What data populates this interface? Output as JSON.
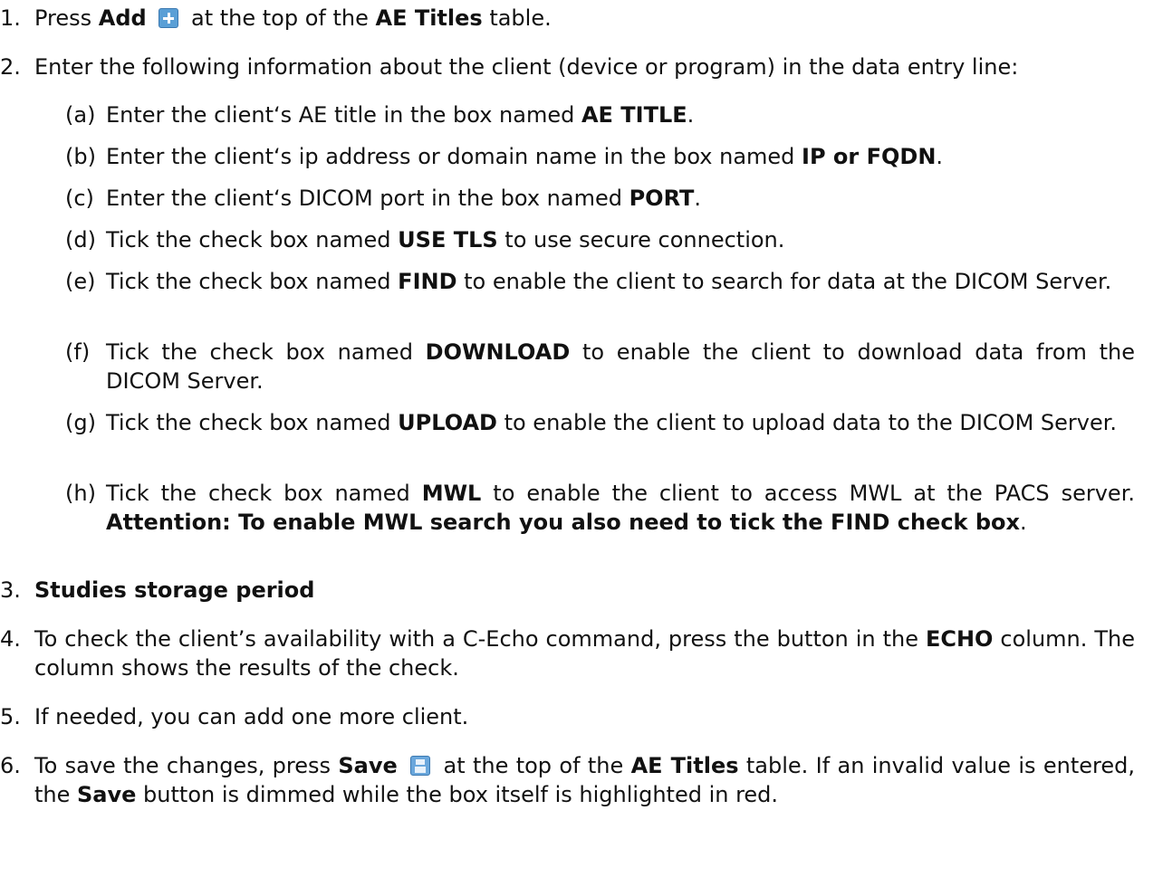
{
  "steps": [
    {
      "num": "1.",
      "before": "Press ",
      "bold1": "Add",
      "mid": " at the top of the ",
      "bold2": "AE Titles",
      "after": " table."
    },
    {
      "num": "2.",
      "text": "Enter the following information about the client (device or program) in the data entry line:"
    },
    {
      "num": "3.",
      "bold": "Studies storage period"
    },
    {
      "num": "4.",
      "before": "To check the client’s availability with a C-Echo command, press the button in the ",
      "bold": "ECHO",
      "after": " column. The column shows the results of the check."
    },
    {
      "num": "5.",
      "text": "If needed, you can add one more client."
    },
    {
      "num": "6.",
      "before": "To save the changes, press ",
      "bold1": "Save",
      "mid": " at the top of the ",
      "bold2": "AE Titles",
      "mid2": " table. If an invalid value is entered, the ",
      "bold3": "Save",
      "after": " button is dimmed while the box itself is highlighted in red."
    }
  ],
  "substeps": [
    {
      "label": "(a)",
      "before": "Enter the client‘s AE title in the box named ",
      "bold": "AE TITLE",
      "after": "."
    },
    {
      "label": "(b)",
      "before": "Enter the client‘s ip address or domain name in the box named ",
      "bold": "IP or FQDN",
      "after": "."
    },
    {
      "label": "(c)",
      "before": "Enter the client‘s DICOM port in the box named ",
      "bold": "PORT",
      "after": "."
    },
    {
      "label": "(d)",
      "before": "Tick the check box named ",
      "bold": "USE TLS",
      "after": " to use secure connection."
    },
    {
      "label": "(e)",
      "before": "Tick the check box named ",
      "bold": "FIND",
      "after": " to enable the client to search for data at the DICOM Server."
    },
    {
      "label": "(f)",
      "before": "Tick the check box named ",
      "bold": "DOWNLOAD",
      "after": " to enable the client to download data from the DICOM Server."
    },
    {
      "label": "(g)",
      "before": "Tick the check box named ",
      "bold": "UPLOAD",
      "after": " to enable the client to upload data to the DICOM Server."
    },
    {
      "label": "(h)",
      "before": "Tick the check box named ",
      "bold": "MWL",
      "after": " to enable the client to access MWL at the PACS server. ",
      "bold2": "Attention: To enable MWL search you also need to tick the FIND check box",
      "after2": "."
    }
  ],
  "icons": {
    "add": "add-plus-icon",
    "save": "save-floppy-icon"
  }
}
